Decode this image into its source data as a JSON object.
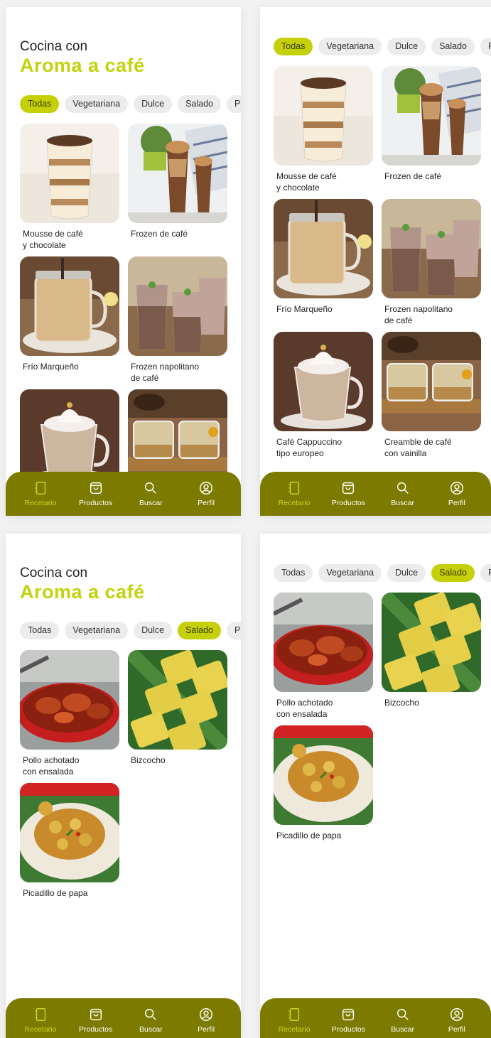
{
  "header": {
    "line1": "Cocina con",
    "line2": "Aroma a café"
  },
  "filters": [
    "Todas",
    "Vegetariana",
    "Dulce",
    "Salado",
    "Pro"
  ],
  "recipes_all": [
    {
      "name": "Mousse de café\ny chocolate",
      "image": "mousse"
    },
    {
      "name": "Frozen de café",
      "image": "frozen"
    },
    {
      "name": "Frío Marqueño",
      "image": "frio"
    },
    {
      "name": "Frozen napolitano\nde café",
      "image": "napolitano"
    },
    {
      "name": "Café Cappuccino\ntipo europeo",
      "image": "cappuccino"
    },
    {
      "name": "Creamble de café\ncon vainilla",
      "image": "creamble"
    }
  ],
  "recipes_salado": [
    {
      "name": "Pollo achotado\ncon ensalada",
      "image": "pollo"
    },
    {
      "name": "Bizcocho",
      "image": "bizcocho"
    },
    {
      "name": "Picadillo de papa",
      "image": "picadillo"
    }
  ],
  "nav": [
    {
      "label": "Recetario",
      "icon": "notebook-icon"
    },
    {
      "label": "Productos",
      "icon": "shopping-bag-icon"
    },
    {
      "label": "Buscar",
      "icon": "search-icon"
    },
    {
      "label": "Perfil",
      "icon": "user-circle-icon"
    }
  ],
  "colors": {
    "accent": "#c5cf0a",
    "nav_bg": "#7c7b00",
    "nav_active": "#cad61a"
  }
}
